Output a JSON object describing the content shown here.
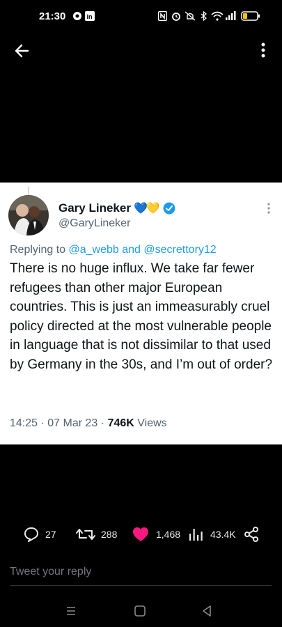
{
  "status_bar": {
    "time": "21:30",
    "left_icons": [
      "settings-icon",
      "linkedin-icon"
    ],
    "right_icons": [
      "nfc-icon",
      "alarm-icon",
      "mute-icon",
      "bluetooth-icon",
      "wifi-icon",
      "signal-icon",
      "battery-icon"
    ]
  },
  "tweet": {
    "author_name": "Gary Lineker",
    "author_emoji": "💙💛",
    "handle": "@GaryLineker",
    "replying_prefix": "Replying to",
    "replying_user1": "@a_webb",
    "replying_and": "and",
    "replying_user2": "@secrettory12",
    "text": "There is no huge influx. We take far fewer refugees than other major European countries. This is just an immeasurably cruel policy directed at the most vulnerable people in language that is not dissimilar to that used by Germany in the 30s, and I’m out of order?",
    "time": "14:25",
    "date": "07 Mar 23",
    "sep": "·",
    "views_count": "746K",
    "views_label": "Views"
  },
  "actions": {
    "replies": "27",
    "retweets": "288",
    "likes": "1,468",
    "impressions": "43.4K"
  },
  "reply_box": {
    "placeholder": "Tweet your reply"
  },
  "colors": {
    "accent": "#1d9bf0",
    "like": "#f91880",
    "verified": "#1d9bf0"
  }
}
